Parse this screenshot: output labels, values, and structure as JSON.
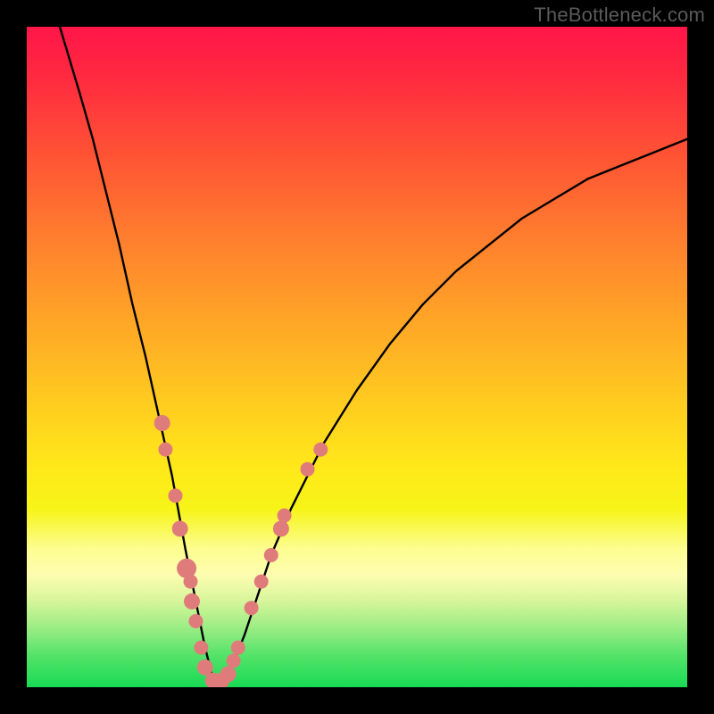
{
  "watermark": "TheBottleneck.com",
  "colors": {
    "curve": "#000000",
    "marker_fill": "#e07b7b",
    "marker_stroke": "#d86f6f",
    "background_black": "#000000"
  },
  "chart_data": {
    "type": "line",
    "title": "",
    "xlabel": "",
    "ylabel": "",
    "xlim": [
      0,
      100
    ],
    "ylim": [
      0,
      100
    ],
    "grid": false,
    "legend": false,
    "notes": "No numeric axis tick labels are rendered in the image; x and y are normalized to a 0–100 visual scale. y represents bottleneck mismatch (higher = worse, red; lower = better, green). The single black curve descends steeply from top-left to a minimum near x≈28 then rises toward upper right.",
    "series": [
      {
        "name": "bottleneck-curve",
        "x": [
          5,
          8,
          10,
          12,
          14,
          16,
          18,
          20,
          22,
          24,
          25,
          26,
          27,
          28,
          29,
          30,
          31,
          33,
          35,
          37,
          40,
          45,
          50,
          55,
          60,
          65,
          70,
          75,
          80,
          85,
          90,
          95,
          100
        ],
        "y": [
          100,
          90,
          83,
          75,
          67,
          58,
          50,
          41,
          32,
          21,
          16,
          11,
          6,
          2,
          1,
          1,
          3,
          8,
          14,
          20,
          27,
          37,
          45,
          52,
          58,
          63,
          67,
          71,
          74,
          77,
          79,
          81,
          83
        ]
      }
    ],
    "markers": {
      "name": "highlighted-points",
      "note": "Salmon circular markers clustered on both flanks of the valley; approximate visual positions.",
      "points": [
        {
          "x": 20.5,
          "y": 40,
          "r": 9
        },
        {
          "x": 21.0,
          "y": 36,
          "r": 8
        },
        {
          "x": 22.5,
          "y": 29,
          "r": 8
        },
        {
          "x": 23.2,
          "y": 24,
          "r": 9
        },
        {
          "x": 24.2,
          "y": 18,
          "r": 11
        },
        {
          "x": 24.8,
          "y": 16,
          "r": 8
        },
        {
          "x": 25.0,
          "y": 13,
          "r": 9
        },
        {
          "x": 25.6,
          "y": 10,
          "r": 8
        },
        {
          "x": 26.4,
          "y": 6,
          "r": 8
        },
        {
          "x": 27.0,
          "y": 3,
          "r": 9
        },
        {
          "x": 28.2,
          "y": 1,
          "r": 9
        },
        {
          "x": 29.5,
          "y": 1,
          "r": 9
        },
        {
          "x": 30.5,
          "y": 2,
          "r": 9
        },
        {
          "x": 31.3,
          "y": 4,
          "r": 8
        },
        {
          "x": 32.0,
          "y": 6,
          "r": 8
        },
        {
          "x": 34.0,
          "y": 12,
          "r": 8
        },
        {
          "x": 35.5,
          "y": 16,
          "r": 8
        },
        {
          "x": 37.0,
          "y": 20,
          "r": 8
        },
        {
          "x": 38.5,
          "y": 24,
          "r": 9
        },
        {
          "x": 39.0,
          "y": 26,
          "r": 8
        },
        {
          "x": 42.5,
          "y": 33,
          "r": 8
        },
        {
          "x": 44.5,
          "y": 36,
          "r": 8
        }
      ]
    }
  }
}
